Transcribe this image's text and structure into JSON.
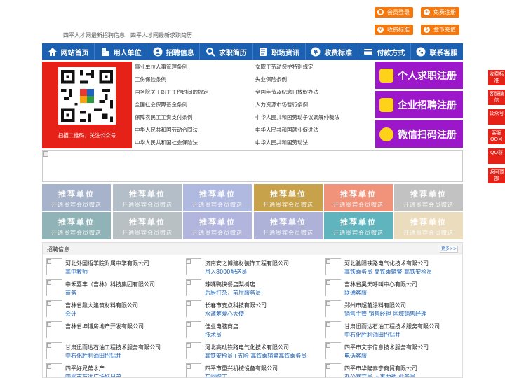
{
  "top_buttons": {
    "member_login": "会员登录",
    "free_register": "免费注册",
    "fee_standard": "收费标准",
    "coin_recharge": "金币充值"
  },
  "subtitle": "四平人才网最新招聘信息　四平人才网最新求职简历",
  "nav": [
    "网站首页",
    "用人单位",
    "招聘信息",
    "求职简历",
    "职场资讯",
    "收费标准",
    "付款方式",
    "联系客服"
  ],
  "qr_caption": "扫描二维码，关注公众号",
  "rules": [
    "事业单位人事管理条例",
    "女职工劳动保护特别规定",
    "工伤保险条例",
    "失业保险条例",
    "国务院关于职工工作时间的规定",
    "全国年节及纪念日放假办法",
    "全国社会保障基金条例",
    "人力资源市场暂行条例",
    "保障农民工工资支付条例",
    "中华人民共和国劳动争议调解仲裁法",
    "中华人民共和国劳动合同法",
    "中华人民共和国就业促进法",
    "中华人民共和国社会保险法",
    "中华人民共和国劳动法"
  ],
  "register": {
    "personal": "个人求职注册",
    "company": "企业招聘注册",
    "wechat": "微信扫码注册"
  },
  "recommend": {
    "title": "推荐单位",
    "sub": "开通贵宾会员赠送",
    "colors": [
      "#a6b3cb",
      "#b3bec8",
      "#b0b9e0",
      "#c8a24a",
      "#f0937a",
      "#c2c2c2",
      "#8fb3b6",
      "#b8c0c4",
      "#b2b5dd",
      "#aeb2d9",
      "#5fb4bd",
      "#ecdcbe"
    ]
  },
  "jobs_section": {
    "title": "招聘信息",
    "more": "更多>>",
    "items": [
      {
        "company": "河北外国语学院附属中学有限公司",
        "positions": "高中教师"
      },
      {
        "company": "济南安之博建材装饰工程有限公司",
        "positions": "月入8000配送员"
      },
      {
        "company": "河北驰阳铁路电气化技术有限公司",
        "positions": "高铁乘务员 高铁乘辅警 高铁安检员"
      },
      {
        "company": "中禾嘉丰（吉林）科技集团有限公司",
        "positions": "商务"
      },
      {
        "company": "辣嘴鸭快餐店梨树店",
        "positions": "后厨打杂，前厅服务员"
      },
      {
        "company": "吉林省昊天呼叫中心有限公司",
        "positions": "联通客服"
      },
      {
        "company": "吉林省鼎大建筑材料有限公司",
        "positions": "会计"
      },
      {
        "company": "长春市支点科技有限公司",
        "positions": "水滴筹爱心大使"
      },
      {
        "company": "郑州市超前涂料有限公司",
        "positions": "销售主管 销售经理 区域销售经理"
      },
      {
        "company": "吉林省坤博房地产开发有限公司",
        "positions": ""
      },
      {
        "company": "佳业电脑商店",
        "positions": "技术员"
      },
      {
        "company": "甘肃迅而达石油工程技术服务有限公司",
        "positions": "中石化胜利油田招钻井"
      },
      {
        "company": "甘肃迅而达石油工程技术服务有限公司",
        "positions": "中石化胜利油田招钻井"
      },
      {
        "company": "河北高动铁路电气化技术有限公司",
        "positions": "高铁安检员+五险 高铁乘辅警高铁乘务员"
      },
      {
        "company": "四平市文宇信息技术服务有限公司",
        "positions": "电话客服"
      },
      {
        "company": "四平好兄弟水产",
        "positions": "四平市万达广场好兄弟"
      },
      {
        "company": "四平市重兴机械设备有限公司",
        "positions": "车间焊工"
      },
      {
        "company": "四平市华隆泰宁商贸有限公司",
        "positions": "办公室文员 人事助理 业务员"
      }
    ]
  },
  "side_float": [
    "收费标准",
    "客服微信",
    "公众号",
    "客服QQ号",
    "QQ群",
    "返回顶部"
  ]
}
